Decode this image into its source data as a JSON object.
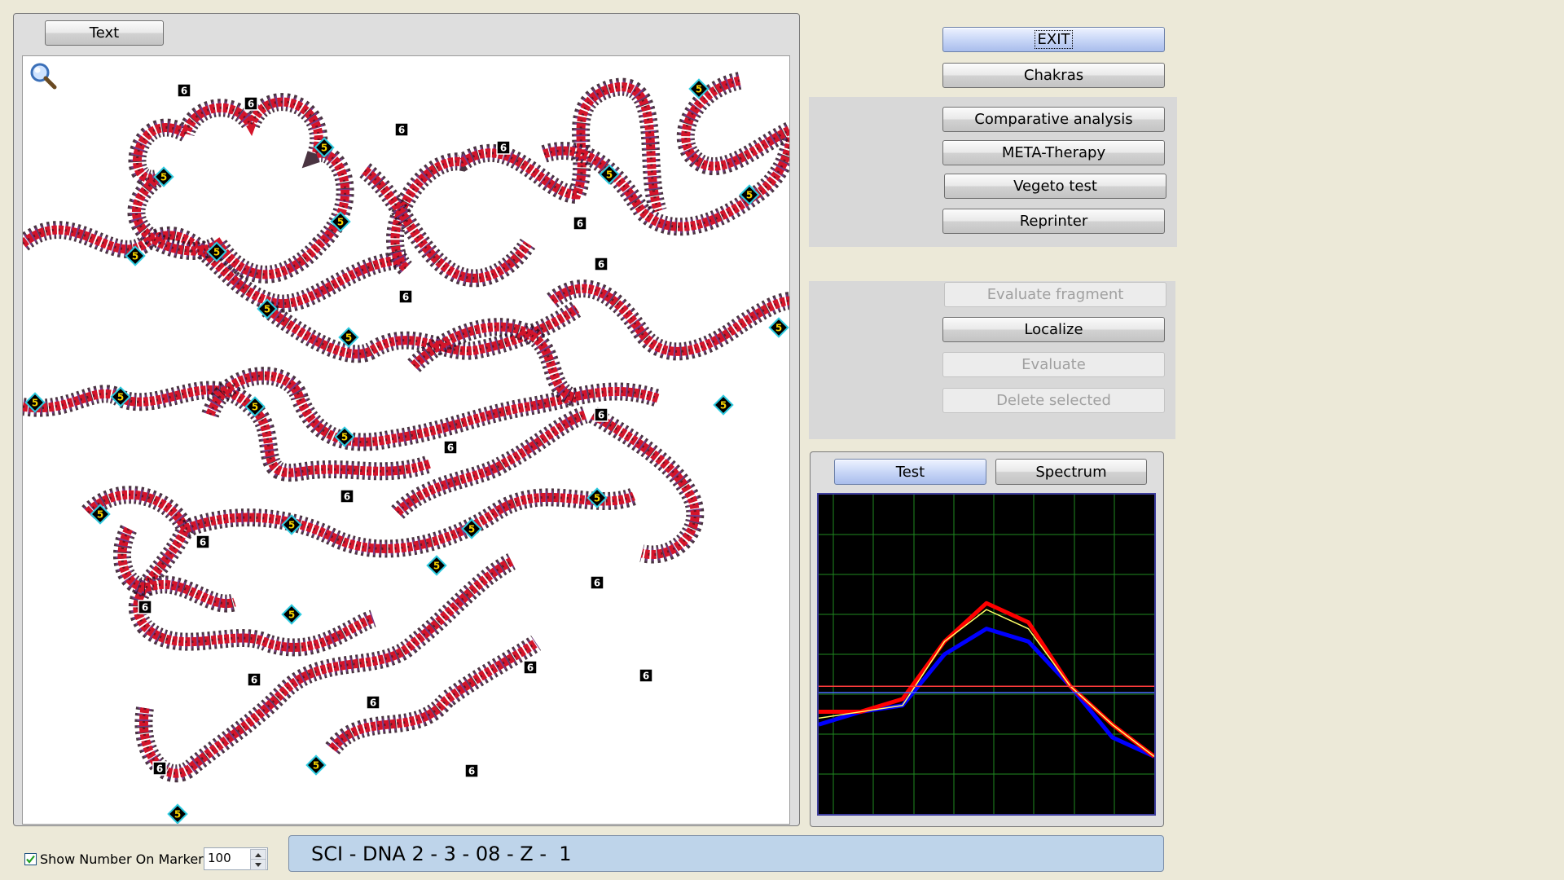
{
  "image_panel": {
    "text_button": "Text",
    "zoom_icon": "magnifier-icon",
    "markers": [
      {
        "type": "6",
        "label": "6"
      },
      {
        "type": "6",
        "label": "6"
      },
      {
        "type": "5",
        "label": "5"
      },
      {
        "type": "5",
        "label": "5"
      },
      {
        "type": "5",
        "label": "5"
      },
      {
        "type": "5",
        "label": "5"
      },
      {
        "type": "5",
        "label": "5"
      },
      {
        "type": "5",
        "label": "5"
      },
      {
        "type": "6",
        "label": "6"
      },
      {
        "type": "5",
        "label": "5"
      },
      {
        "type": "6",
        "label": "6"
      },
      {
        "type": "6",
        "label": "6"
      },
      {
        "type": "6",
        "label": "6"
      },
      {
        "type": "6",
        "label": "6"
      },
      {
        "type": "5",
        "label": "5"
      },
      {
        "type": "5",
        "label": "5"
      },
      {
        "type": "5",
        "label": "5"
      },
      {
        "type": "5",
        "label": "5"
      },
      {
        "type": "5",
        "label": "5"
      },
      {
        "type": "6",
        "label": "6"
      },
      {
        "type": "5",
        "label": "5"
      },
      {
        "type": "5",
        "label": "5"
      },
      {
        "type": "5",
        "label": "5"
      },
      {
        "type": "6",
        "label": "6"
      },
      {
        "type": "5",
        "label": "5"
      },
      {
        "type": "6",
        "label": "6"
      },
      {
        "type": "6",
        "label": "6"
      },
      {
        "type": "5",
        "label": "5"
      },
      {
        "type": "5",
        "label": "5"
      },
      {
        "type": "5",
        "label": "5"
      },
      {
        "type": "5",
        "label": "5"
      },
      {
        "type": "6",
        "label": "6"
      },
      {
        "type": "6",
        "label": "6"
      },
      {
        "type": "5",
        "label": "5"
      },
      {
        "type": "5",
        "label": "5"
      },
      {
        "type": "6",
        "label": "6"
      },
      {
        "type": "6",
        "label": "6"
      },
      {
        "type": "6",
        "label": "6"
      },
      {
        "type": "6",
        "label": "6"
      },
      {
        "type": "6",
        "label": "6"
      },
      {
        "type": "5",
        "label": "5"
      },
      {
        "type": "6",
        "label": "6"
      },
      {
        "type": "5",
        "label": "5"
      }
    ]
  },
  "buttons": {
    "exit": "EXIT",
    "chakras": "Chakras",
    "comparative": "Comparative analysis",
    "meta": "META-Therapy",
    "vegeto": "Vegeto test",
    "reprinter": "Reprinter",
    "evaluate_fragment": "Evaluate fragment",
    "localize": "Localize",
    "evaluate": "Evaluate",
    "delete_selected": "Delete selected"
  },
  "graph_panel": {
    "tabs": [
      {
        "label": "Test",
        "active": true
      },
      {
        "label": "Spectrum",
        "active": false
      }
    ],
    "grid": {
      "columns": 8,
      "rows": 8,
      "color": "#1f8a1f"
    },
    "chart_data": {
      "type": "line",
      "x": [
        0,
        1,
        2,
        3,
        4,
        5,
        6,
        7,
        8
      ],
      "series": [
        {
          "color": "#ff0000",
          "values": [
            16,
            16,
            18,
            27,
            33,
            30,
            20,
            14,
            9
          ]
        },
        {
          "color": "#ffff66",
          "values": [
            15,
            16,
            17,
            27,
            32,
            29,
            20,
            14,
            9
          ]
        },
        {
          "color": "#0000ff",
          "values": [
            14,
            16,
            17,
            25,
            29,
            27,
            20,
            12,
            9
          ]
        },
        {
          "color": "#ff3b3b",
          "values": [
            20,
            20,
            20,
            20,
            20,
            20,
            20,
            20,
            20
          ]
        },
        {
          "color": "#4a6cff",
          "values": [
            19,
            19,
            19,
            19,
            19,
            19,
            19,
            19,
            19
          ]
        }
      ],
      "ylim": [
        0,
        50
      ]
    }
  },
  "footer": {
    "show_number_label": "Show Number On Marker",
    "show_number_checked": true,
    "spin_value": "100",
    "status_text": "SCI - DNA 2 - 3 - 08 - Z -  1"
  },
  "colors": {
    "strand_red": "#d4142a",
    "strand_dark": "#2a1020",
    "strand_purple": "#8a3aa8",
    "marker5_border": "#2ecbe0",
    "marker6_bg": "#000000"
  }
}
